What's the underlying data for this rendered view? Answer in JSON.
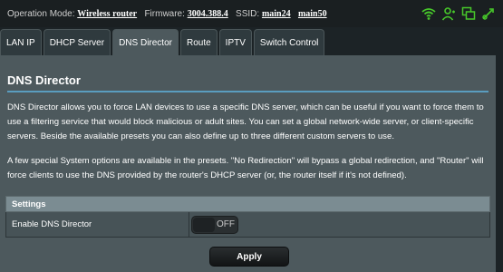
{
  "status": {
    "operation_mode_label": "Operation Mode:",
    "operation_mode_value": "Wireless router",
    "firmware_label": "Firmware:",
    "firmware_value": "3004.388.4",
    "ssid_label": "SSID:",
    "ssid_1": "main24",
    "ssid_2": "main50",
    "icons": [
      "wifi-icon",
      "user-icon",
      "network-icon",
      "usb-icon"
    ],
    "icon_color": "#47c82a"
  },
  "tabs": [
    {
      "label": "LAN IP",
      "active": false
    },
    {
      "label": "DHCP Server",
      "active": false
    },
    {
      "label": "DNS Director",
      "active": true
    },
    {
      "label": "Route",
      "active": false
    },
    {
      "label": "IPTV",
      "active": false
    },
    {
      "label": "Switch Control",
      "active": false
    }
  ],
  "panel": {
    "title": "DNS Director",
    "desc_1": "DNS Director allows you to force LAN devices to use a specific DNS server, which can be useful if you want to force them to use a filtering service that would block malicious or adult sites. You can set a global network-wide server, or client-specific servers. Beside the available presets you can also define up to three different custom servers to use.",
    "desc_2": "A few special System options are available in the presets. \"No Redirection\" will bypass a global redirection, and \"Router\" will force clients to use the DNS provided by the router's DHCP server (or, the router itself if it's not defined).",
    "settings_header": "Settings",
    "enable_label": "Enable DNS Director",
    "enable_state": "OFF",
    "apply_label": "Apply"
  },
  "colors": {
    "accent_rule": "#5a9dbf",
    "panel_bg": "#4d595d",
    "page_bg": "#1c2326"
  }
}
